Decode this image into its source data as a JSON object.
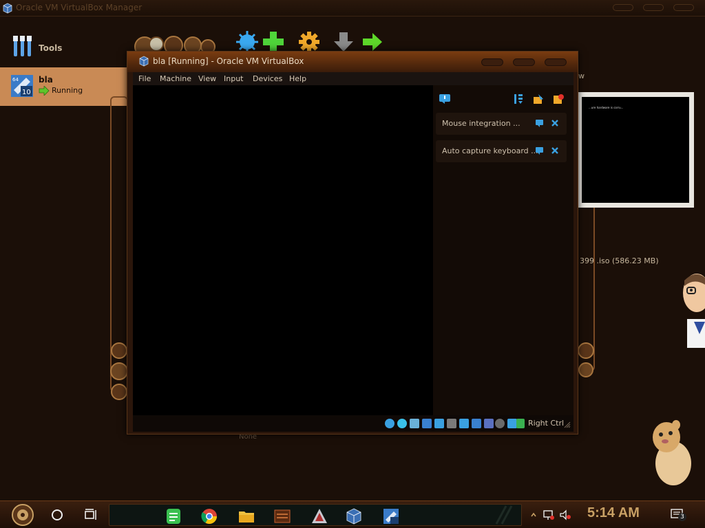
{
  "manager": {
    "title": "Oracle VM VirtualBox Manager",
    "tools_label": "Tools",
    "vm": {
      "name": "bla",
      "state": "Running"
    },
    "preview_label": "w",
    "iso_text": "399 .iso (586.23 MB)",
    "none_text": "None",
    "preview_screen_text": "...ure hardware is corru..."
  },
  "vm_window": {
    "title": "bla [Running] - Oracle VM VirtualBox",
    "menu": [
      "File",
      "Machine",
      "View",
      "Input",
      "Devices",
      "Help"
    ],
    "notifications": [
      {
        "text": "Mouse integration ..."
      },
      {
        "text": "Auto capture keyboard ..."
      }
    ],
    "host_key": "Right Ctrl"
  },
  "taskbar": {
    "clock": "5:14 AM",
    "notification_count": "3"
  },
  "colors": {
    "accent": "#c98a55",
    "title_gradient_top": "#7a3c10",
    "clock": "#c8a064"
  }
}
